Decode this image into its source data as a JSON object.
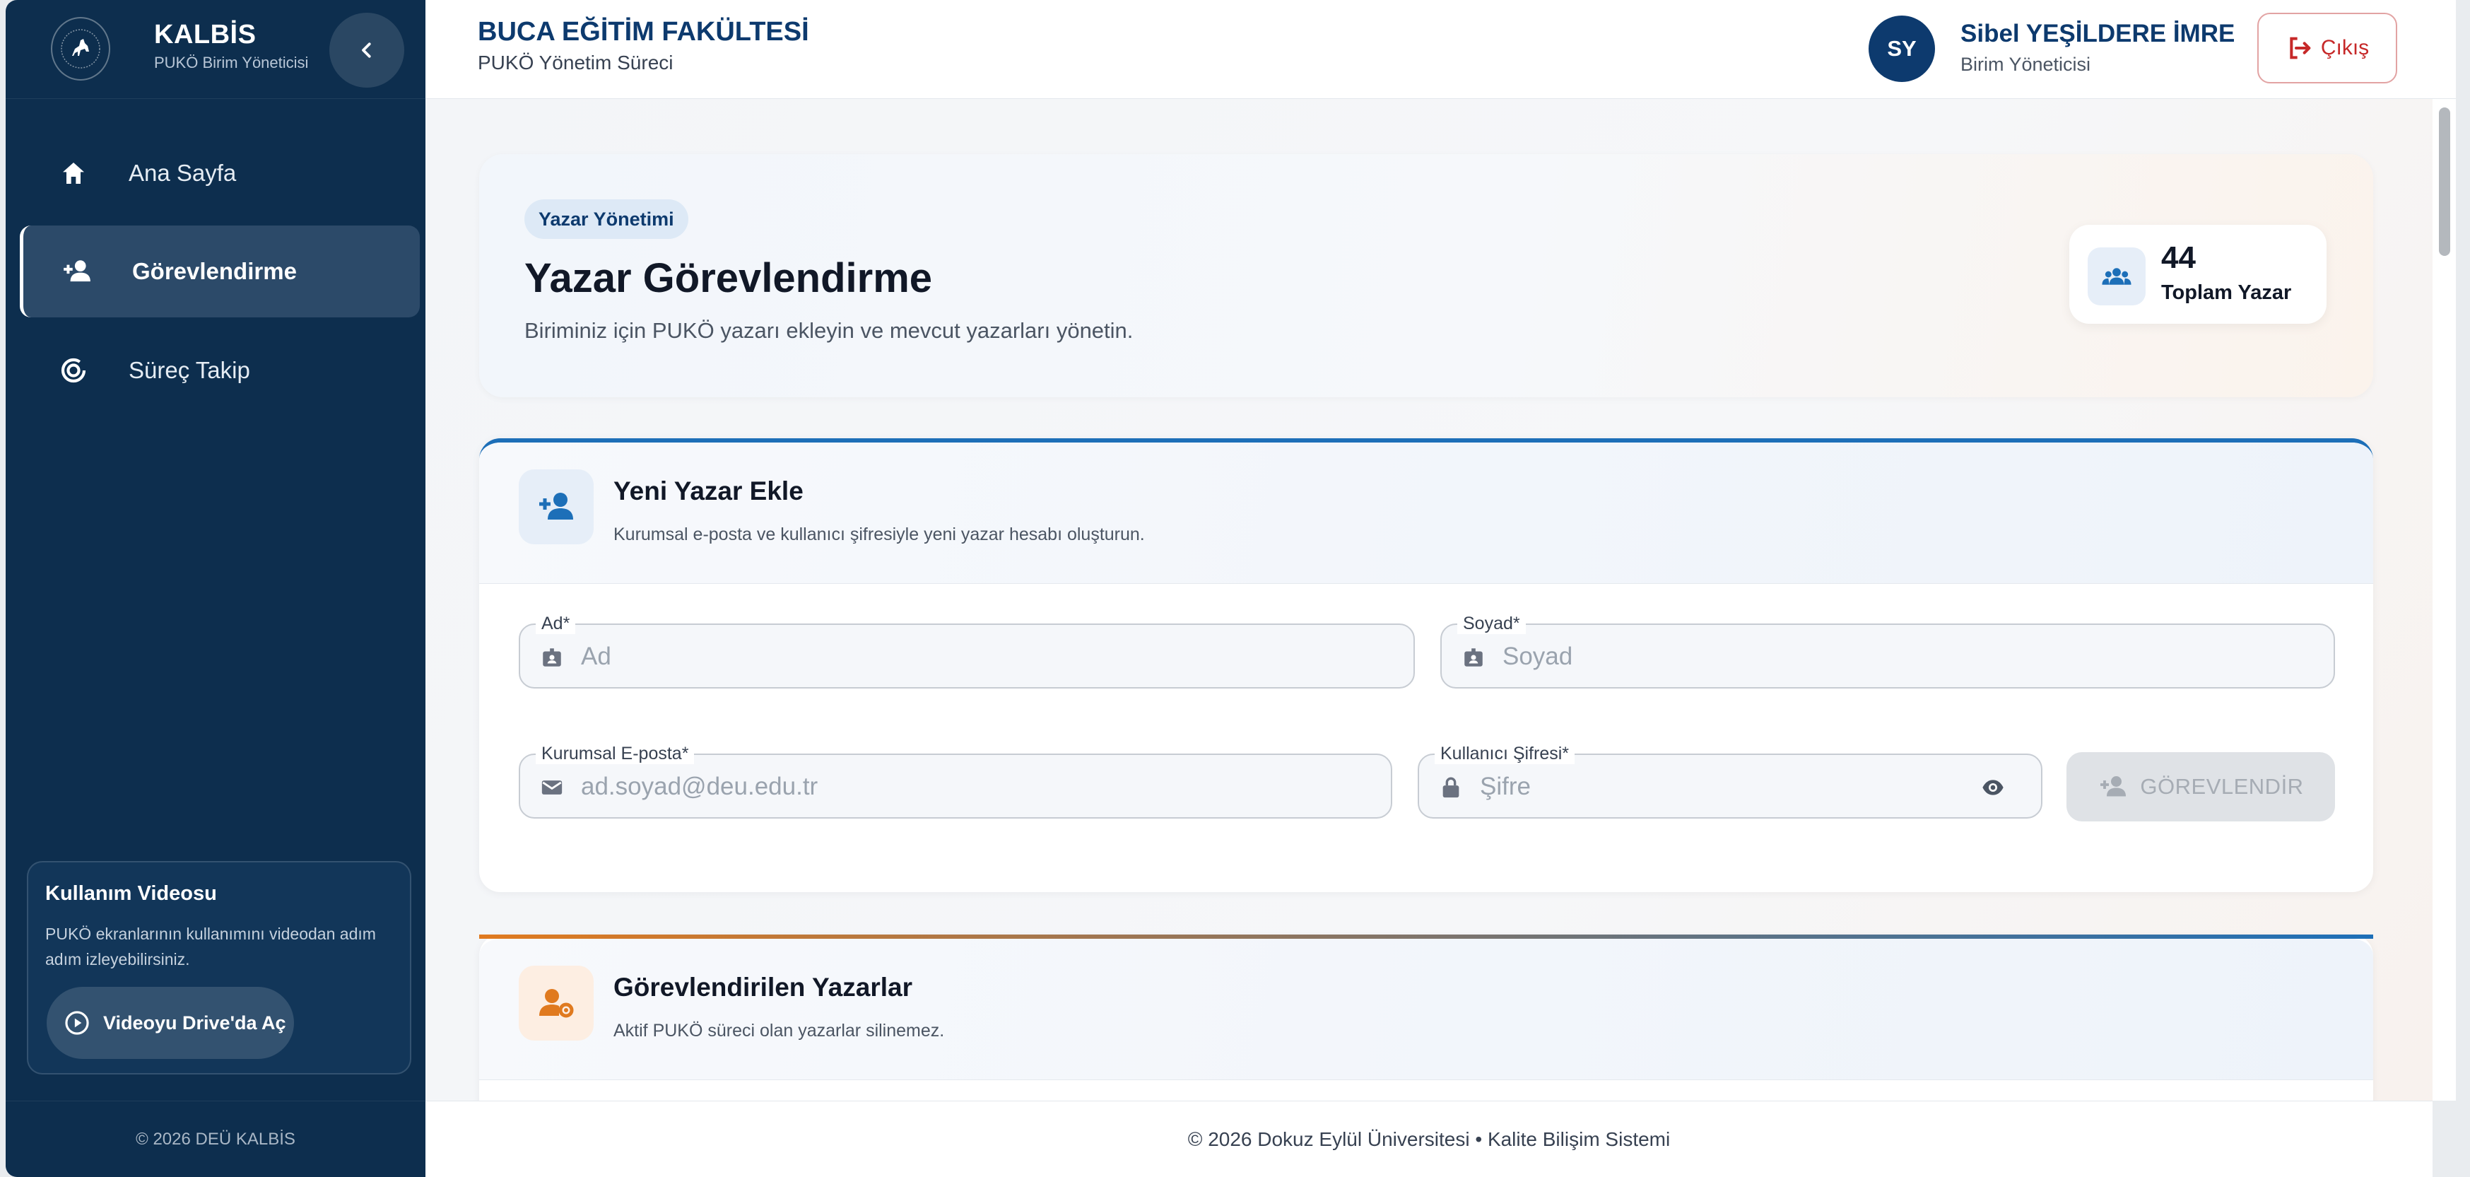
{
  "sidebar": {
    "app_title": "KALBİS",
    "app_subtitle": "PUKÖ Birim Yöneticisi",
    "nav": [
      {
        "label": "Ana Sayfa",
        "icon": "home-icon",
        "active": false
      },
      {
        "label": "Görevlendirme",
        "icon": "person-add-icon",
        "active": true
      },
      {
        "label": "Süreç Takip",
        "icon": "progress-icon",
        "active": false
      }
    ],
    "video": {
      "title": "Kullanım Videosu",
      "description": "PUKÖ ekranlarının kullanımını videodan adım adım izleyebilirsiniz.",
      "button": "Videoyu Drive'da Aç"
    },
    "footer": "© 2026 DEÜ KALBİS"
  },
  "topbar": {
    "faculty": "BUCA EĞİTİM FAKÜLTESİ",
    "process": "PUKÖ Yönetim Süreci",
    "user_initials": "SY",
    "user_name": "Sibel YEŞİLDERE İMRE",
    "user_role": "Birim Yöneticisi",
    "logout": "Çıkış"
  },
  "hero": {
    "chip": "Yazar Yönetimi",
    "title": "Yazar Görevlendirme",
    "description": "Biriminiz için PUKÖ yazarı ekleyin ve mevcut yazarları yönetin.",
    "stat_value": "44",
    "stat_label": "Toplam Yazar"
  },
  "add_author": {
    "title": "Yeni Yazar Ekle",
    "subtitle": "Kurumsal e-posta ve kullanıcı şifresiyle yeni yazar hesabı oluşturun.",
    "fields": {
      "first_name": {
        "label": "Ad",
        "required": "*",
        "placeholder": "Ad",
        "value": ""
      },
      "last_name": {
        "label": "Soyad",
        "required": "*",
        "placeholder": "Soyad",
        "value": ""
      },
      "email": {
        "label": "Kurumsal E-posta",
        "required": "*",
        "placeholder": "ad.soyad@deu.edu.tr",
        "value": ""
      },
      "password": {
        "label": "Kullanıcı Şifresi",
        "required": "*",
        "placeholder": "Şifre",
        "value": ""
      }
    },
    "submit": "GÖREVLENDİR"
  },
  "assigned_authors": {
    "title": "Görevlendirilen Yazarlar",
    "subtitle": "Aktif PUKÖ süreci olan yazarlar silinemez."
  },
  "footer": "© 2026 Dokuz Eylül Üniversitesi • Kalite Bilişim Sistemi",
  "colors": {
    "sidebar_bg": "#0d2e4e",
    "primary": "#0d3a6e",
    "accent_blue": "#1d6fb8",
    "accent_orange": "#e07a1f",
    "danger": "#c62828"
  }
}
